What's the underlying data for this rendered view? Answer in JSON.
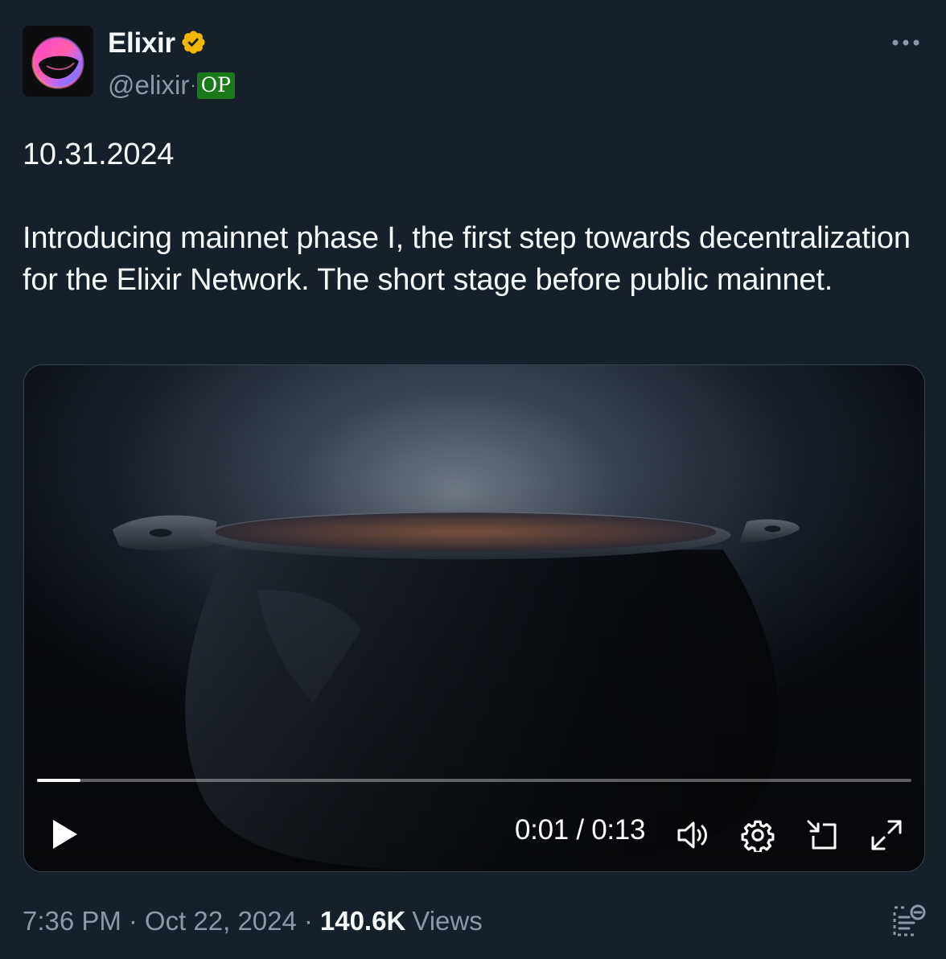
{
  "author": {
    "display_name": "Elixir",
    "handle": "@elixir",
    "handle_separator": "·",
    "op_badge": "OP",
    "avatar_icon": "elixir-logo",
    "verified_icon": "gold-verified-badge",
    "verified_color": "#f2b600"
  },
  "more_icon": "more-dots-icon",
  "tweet": {
    "text": "10.31.2024\n\nIntroducing mainnet phase I, the first step towards decentralization for the Elixir Network. The short stage before public mainnet."
  },
  "video": {
    "progress": 0.05,
    "time_readout": "0:01 / 0:13",
    "controls": {
      "play_icon": "play-icon",
      "volume_icon": "volume-icon",
      "settings_icon": "gear-icon",
      "pip_icon": "picture-in-picture-icon",
      "fullscreen_icon": "fullscreen-icon"
    }
  },
  "meta": {
    "time": "7:36 PM",
    "separator": "·",
    "date": "Oct 22, 2024",
    "views_count": "140.6K",
    "views_label": "Views"
  },
  "colors": {
    "background": "#15202b",
    "text_primary": "#f7f9f9",
    "text_secondary": "#8b98a5",
    "op_badge": "#1a7a1a"
  }
}
